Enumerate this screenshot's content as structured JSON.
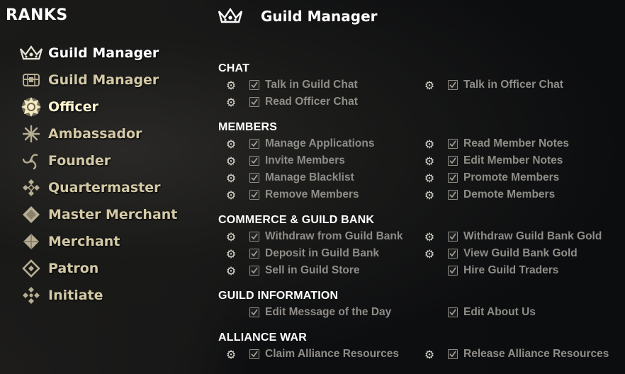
{
  "ranks_panel": {
    "title": "RANKS",
    "items": [
      {
        "label": "Guild Manager",
        "icon": "crown-icon",
        "selected": true
      },
      {
        "label": "Guild Manager",
        "icon": "chest-icon"
      },
      {
        "label": "Officer",
        "icon": "sun-badge-icon",
        "highlight": true
      },
      {
        "label": "Ambassador",
        "icon": "star-burst-icon"
      },
      {
        "label": "Founder",
        "icon": "triskelion-icon"
      },
      {
        "label": "Quartermaster",
        "icon": "diamond-cluster-icon"
      },
      {
        "label": "Master Merchant",
        "icon": "diamond-icon"
      },
      {
        "label": "Merchant",
        "icon": "diamond-icon"
      },
      {
        "label": "Patron",
        "icon": "hollow-diamond-icon"
      },
      {
        "label": "Initiate",
        "icon": "diamond-cluster-icon"
      }
    ]
  },
  "header": {
    "title": "Guild Manager",
    "icon": "crown-icon"
  },
  "sections": {
    "chat": {
      "title": "CHAT",
      "perms": [
        {
          "label": "Talk in Guild Chat",
          "gear": true
        },
        {
          "label": "Talk in Officer Chat",
          "gear": true
        },
        {
          "label": "Read Officer Chat",
          "gear": true
        }
      ]
    },
    "members": {
      "title": "MEMBERS",
      "perms": [
        {
          "label": "Manage Applications",
          "gear": true
        },
        {
          "label": "Read Member Notes",
          "gear": true
        },
        {
          "label": "Invite Members",
          "gear": true
        },
        {
          "label": "Edit Member Notes",
          "gear": true
        },
        {
          "label": "Manage Blacklist",
          "gear": true
        },
        {
          "label": "Promote Members",
          "gear": true
        },
        {
          "label": "Remove Members",
          "gear": true
        },
        {
          "label": "Demote Members",
          "gear": true
        }
      ]
    },
    "commerce": {
      "title": "COMMERCE & GUILD BANK",
      "perms": [
        {
          "label": "Withdraw from Guild Bank",
          "gear": true
        },
        {
          "label": "Withdraw Guild Bank Gold",
          "gear": true
        },
        {
          "label": "Deposit in Guild Bank",
          "gear": true
        },
        {
          "label": "View Guild Bank Gold",
          "gear": true
        },
        {
          "label": "Sell in Guild Store",
          "gear": true
        },
        {
          "label": "Hire Guild Traders",
          "gear": false
        }
      ]
    },
    "guild_info": {
      "title": "GUILD INFORMATION",
      "perms": [
        {
          "label": "Edit Message of the Day",
          "gear": false
        },
        {
          "label": "Edit About Us",
          "gear": false
        }
      ]
    },
    "alliance_war": {
      "title": "ALLIANCE WAR",
      "perms": [
        {
          "label": "Claim Alliance Resources",
          "gear": true
        },
        {
          "label": "Release Alliance Resources",
          "gear": true
        }
      ]
    }
  },
  "colors": {
    "accent_white": "#ffffff",
    "rank_text": "#d3c9a6",
    "perm_text": "#8f8d88"
  }
}
